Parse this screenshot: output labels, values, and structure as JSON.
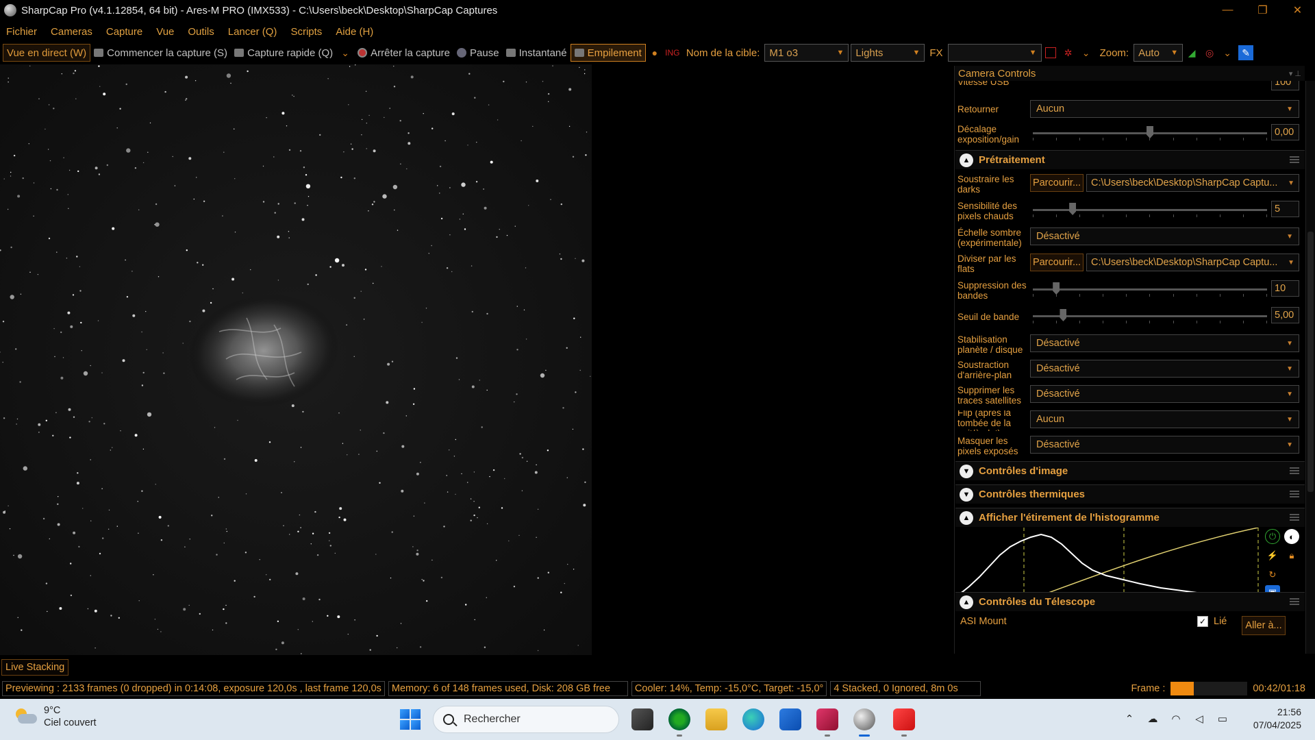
{
  "titlebar": {
    "title": "SharpCap Pro (v4.1.12854, 64 bit) - Ares-M PRO (IMX533) - C:\\Users\\beck\\Desktop\\SharpCap Captures",
    "minimize": "—",
    "restore": "❐",
    "close": "✕"
  },
  "menu": [
    "Fichier",
    "Cameras",
    "Capture",
    "Vue",
    "Outils",
    "Lancer (Q)",
    "Scripts",
    "Aide (H)"
  ],
  "toolbar": {
    "live_view": "Vue en direct (W)",
    "start_capture": "Commencer la capture (S)",
    "quick_capture": "Capture rapide (Q)",
    "stop_capture": "Arrêter la capture",
    "pause": "Pause",
    "snapshot": "Instantané",
    "stacking": "Empilement",
    "target_label": "Nom de la cible:",
    "target_value": "M1 o3",
    "frame_type": "Lights",
    "fx_label": "FX",
    "fx_value": "",
    "zoom_label": "Zoom:",
    "zoom_value": "Auto"
  },
  "panel": {
    "header": "Camera Controls",
    "usb_label": "Vitesse USB",
    "usb_value": "100",
    "flip_label": "Retourner",
    "flip_value": "Aucun",
    "offset_label": "Décalage exposition/gain",
    "offset_value": "0,00",
    "offset_knob": 0.5,
    "preprocessing": {
      "title": "Prétraitement",
      "darks_label": "Soustraire les darks",
      "darks_browse": "Parcourir...",
      "darks_path": "C:\\Users\\beck\\Desktop\\SharpCap Captu...",
      "hotpix_label": "Sensibilité des pixels chauds",
      "hotpix_value": "5",
      "hotpix_knob": 0.17,
      "dark_scale_label": "Échelle sombre (expérimentale)",
      "dark_scale_value": "Désactivé",
      "flats_label": "Diviser par les flats",
      "flats_browse": "Parcourir...",
      "flats_path": "C:\\Users\\beck\\Desktop\\SharpCap Captu...",
      "banding_label": "Suppression des bandes",
      "banding_value": "10",
      "banding_knob": 0.1,
      "band_threshold_label": "Seuil de bande",
      "band_threshold_value": "5,00",
      "band_threshold_knob": 0.13,
      "stabilization_label": "Stabilisation planète / disque",
      "stabilization_value": "Désactivé",
      "bg_sub_label": "Soustraction d'arrière-plan",
      "bg_sub_value": "Désactivé",
      "satellite_label": "Supprimer les traces satellites",
      "satellite_value": "Désactivé",
      "flip_flat_label": "Flip (après la tombée de la nuit/à plat)",
      "flip_flat_value": "Aucun",
      "mask_label": "Masquer les pixels exposés",
      "mask_value": "Désactivé"
    },
    "image_controls": "Contrôles d'image",
    "thermal_controls": "Contrôles thermiques",
    "histogram_title": "Afficher l'étirement de l'histogramme",
    "telescope_title": "Contrôles du Télescope",
    "mount_name": "ASI Mount",
    "linked_label": "Lié",
    "goto_button": "Aller à..."
  },
  "live_stacking_tab": "Live Stacking",
  "status": {
    "preview": "Previewing : 2133 frames (0 dropped) in 0:14:08, exposure 120,0s , last frame 120,0s",
    "memory": "Memory: 6 of 148 frames used, Disk: 208 GB free",
    "cooler": "Cooler: 14%, Temp: -15,0°C, Target: -15,0°",
    "stacked": "4 Stacked, 0 Ignored, 8m 0s",
    "frame_label": "Frame :",
    "frame_progress": 0.3,
    "frame_time": "00:42/01:18"
  },
  "taskbar": {
    "weather_temp": "9°C",
    "weather_cond": "Ciel couvert",
    "search_placeholder": "Rechercher",
    "time": "21:56",
    "date": "07/04/2025"
  },
  "colors": {
    "accent": "#e6a040",
    "panel_bg": "#000000",
    "taskbar_bg": "#dde7f0"
  }
}
